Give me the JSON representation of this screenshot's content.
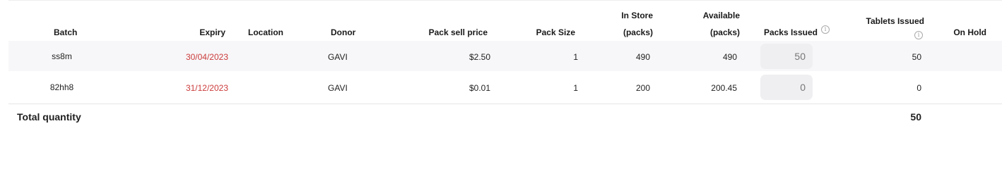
{
  "headers": {
    "batch": "Batch",
    "expiry": "Expiry",
    "location": "Location",
    "donor": "Donor",
    "pack_sell_price": "Pack sell price",
    "pack_size": "Pack Size",
    "in_store_line1": "In Store",
    "in_store_line2": "(packs)",
    "available_line1": "Available",
    "available_line2": "(packs)",
    "packs_issued": "Packs Issued",
    "tablets_issued": "Tablets Issued",
    "on_hold": "On Hold"
  },
  "icons": {
    "info": "info-icon",
    "info_glyph": "i"
  },
  "rows": [
    {
      "batch": "ss8m",
      "expiry": "30/04/2023",
      "location": "",
      "donor": "GAVI",
      "pack_sell_price": "$2.50",
      "pack_size": "1",
      "in_store": "490",
      "available": "490",
      "packs_issued": "50",
      "tablets_issued": "50",
      "on_hold": ""
    },
    {
      "batch": "82hh8",
      "expiry": "31/12/2023",
      "location": "",
      "donor": "GAVI",
      "pack_sell_price": "$0.01",
      "pack_size": "1",
      "in_store": "200",
      "available": "200.45",
      "packs_issued": "0",
      "tablets_issued": "0",
      "on_hold": ""
    }
  ],
  "footer": {
    "label": "Total quantity",
    "total": "50"
  },
  "colors": {
    "expiry_text": "#cc3b3b",
    "row_alt_bg": "#f7f7f9",
    "input_bg": "#efeff2"
  }
}
